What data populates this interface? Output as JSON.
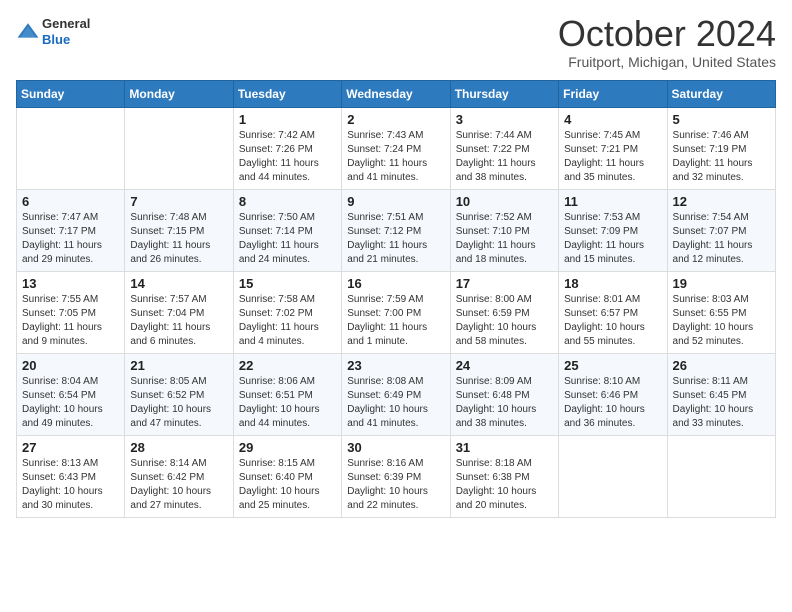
{
  "logo": {
    "general": "General",
    "blue": "Blue"
  },
  "header": {
    "month": "October 2024",
    "location": "Fruitport, Michigan, United States"
  },
  "weekdays": [
    "Sunday",
    "Monday",
    "Tuesday",
    "Wednesday",
    "Thursday",
    "Friday",
    "Saturday"
  ],
  "weeks": [
    [
      {
        "day": "",
        "detail": ""
      },
      {
        "day": "",
        "detail": ""
      },
      {
        "day": "1",
        "detail": "Sunrise: 7:42 AM\nSunset: 7:26 PM\nDaylight: 11 hours and 44 minutes."
      },
      {
        "day": "2",
        "detail": "Sunrise: 7:43 AM\nSunset: 7:24 PM\nDaylight: 11 hours and 41 minutes."
      },
      {
        "day": "3",
        "detail": "Sunrise: 7:44 AM\nSunset: 7:22 PM\nDaylight: 11 hours and 38 minutes."
      },
      {
        "day": "4",
        "detail": "Sunrise: 7:45 AM\nSunset: 7:21 PM\nDaylight: 11 hours and 35 minutes."
      },
      {
        "day": "5",
        "detail": "Sunrise: 7:46 AM\nSunset: 7:19 PM\nDaylight: 11 hours and 32 minutes."
      }
    ],
    [
      {
        "day": "6",
        "detail": "Sunrise: 7:47 AM\nSunset: 7:17 PM\nDaylight: 11 hours and 29 minutes."
      },
      {
        "day": "7",
        "detail": "Sunrise: 7:48 AM\nSunset: 7:15 PM\nDaylight: 11 hours and 26 minutes."
      },
      {
        "day": "8",
        "detail": "Sunrise: 7:50 AM\nSunset: 7:14 PM\nDaylight: 11 hours and 24 minutes."
      },
      {
        "day": "9",
        "detail": "Sunrise: 7:51 AM\nSunset: 7:12 PM\nDaylight: 11 hours and 21 minutes."
      },
      {
        "day": "10",
        "detail": "Sunrise: 7:52 AM\nSunset: 7:10 PM\nDaylight: 11 hours and 18 minutes."
      },
      {
        "day": "11",
        "detail": "Sunrise: 7:53 AM\nSunset: 7:09 PM\nDaylight: 11 hours and 15 minutes."
      },
      {
        "day": "12",
        "detail": "Sunrise: 7:54 AM\nSunset: 7:07 PM\nDaylight: 11 hours and 12 minutes."
      }
    ],
    [
      {
        "day": "13",
        "detail": "Sunrise: 7:55 AM\nSunset: 7:05 PM\nDaylight: 11 hours and 9 minutes."
      },
      {
        "day": "14",
        "detail": "Sunrise: 7:57 AM\nSunset: 7:04 PM\nDaylight: 11 hours and 6 minutes."
      },
      {
        "day": "15",
        "detail": "Sunrise: 7:58 AM\nSunset: 7:02 PM\nDaylight: 11 hours and 4 minutes."
      },
      {
        "day": "16",
        "detail": "Sunrise: 7:59 AM\nSunset: 7:00 PM\nDaylight: 11 hours and 1 minute."
      },
      {
        "day": "17",
        "detail": "Sunrise: 8:00 AM\nSunset: 6:59 PM\nDaylight: 10 hours and 58 minutes."
      },
      {
        "day": "18",
        "detail": "Sunrise: 8:01 AM\nSunset: 6:57 PM\nDaylight: 10 hours and 55 minutes."
      },
      {
        "day": "19",
        "detail": "Sunrise: 8:03 AM\nSunset: 6:55 PM\nDaylight: 10 hours and 52 minutes."
      }
    ],
    [
      {
        "day": "20",
        "detail": "Sunrise: 8:04 AM\nSunset: 6:54 PM\nDaylight: 10 hours and 49 minutes."
      },
      {
        "day": "21",
        "detail": "Sunrise: 8:05 AM\nSunset: 6:52 PM\nDaylight: 10 hours and 47 minutes."
      },
      {
        "day": "22",
        "detail": "Sunrise: 8:06 AM\nSunset: 6:51 PM\nDaylight: 10 hours and 44 minutes."
      },
      {
        "day": "23",
        "detail": "Sunrise: 8:08 AM\nSunset: 6:49 PM\nDaylight: 10 hours and 41 minutes."
      },
      {
        "day": "24",
        "detail": "Sunrise: 8:09 AM\nSunset: 6:48 PM\nDaylight: 10 hours and 38 minutes."
      },
      {
        "day": "25",
        "detail": "Sunrise: 8:10 AM\nSunset: 6:46 PM\nDaylight: 10 hours and 36 minutes."
      },
      {
        "day": "26",
        "detail": "Sunrise: 8:11 AM\nSunset: 6:45 PM\nDaylight: 10 hours and 33 minutes."
      }
    ],
    [
      {
        "day": "27",
        "detail": "Sunrise: 8:13 AM\nSunset: 6:43 PM\nDaylight: 10 hours and 30 minutes."
      },
      {
        "day": "28",
        "detail": "Sunrise: 8:14 AM\nSunset: 6:42 PM\nDaylight: 10 hours and 27 minutes."
      },
      {
        "day": "29",
        "detail": "Sunrise: 8:15 AM\nSunset: 6:40 PM\nDaylight: 10 hours and 25 minutes."
      },
      {
        "day": "30",
        "detail": "Sunrise: 8:16 AM\nSunset: 6:39 PM\nDaylight: 10 hours and 22 minutes."
      },
      {
        "day": "31",
        "detail": "Sunrise: 8:18 AM\nSunset: 6:38 PM\nDaylight: 10 hours and 20 minutes."
      },
      {
        "day": "",
        "detail": ""
      },
      {
        "day": "",
        "detail": ""
      }
    ]
  ]
}
